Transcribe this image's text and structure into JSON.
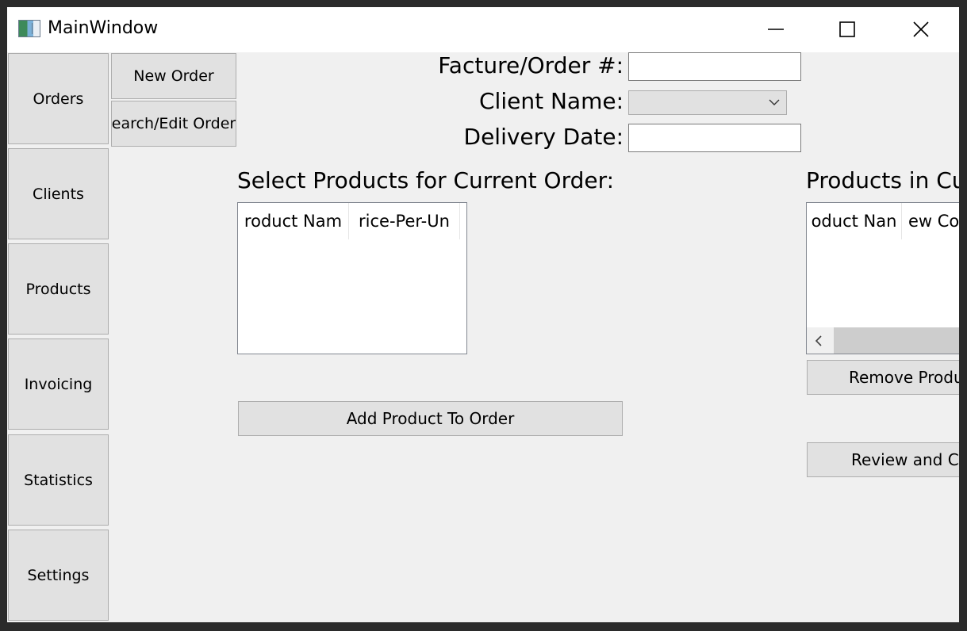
{
  "window": {
    "title": "MainWindow"
  },
  "sidebar": {
    "items": [
      {
        "label": "Orders"
      },
      {
        "label": "Clients"
      },
      {
        "label": "Products"
      },
      {
        "label": "Invoicing"
      },
      {
        "label": "Statistics"
      },
      {
        "label": "Settings"
      }
    ]
  },
  "orders_menu": {
    "new_order": "New Order",
    "search_edit_order": "earch/Edit Order"
  },
  "form": {
    "order_number_label": "Facture/Order #:",
    "order_number_value": "",
    "client_name_label": "Client Name:",
    "client_name_value": "",
    "delivery_date_label": "Delivery Date:",
    "delivery_date_value": ""
  },
  "select_products": {
    "title": "Select Products for Current Order:",
    "columns": [
      "roduct Nam",
      "rice-Per-Un"
    ],
    "add_button": "Add Product To Order"
  },
  "current_products": {
    "title": "Products in Cu",
    "columns": [
      "oduct Nan",
      "ew Co"
    ],
    "remove_button": "Remove Produc",
    "review_button": "Review and Co"
  },
  "icons": {
    "minimize": "minimize-icon",
    "maximize": "maximize-icon",
    "close": "close-icon",
    "combo": "chevron-down-icon",
    "scroll_left": "chevron-left-icon"
  }
}
